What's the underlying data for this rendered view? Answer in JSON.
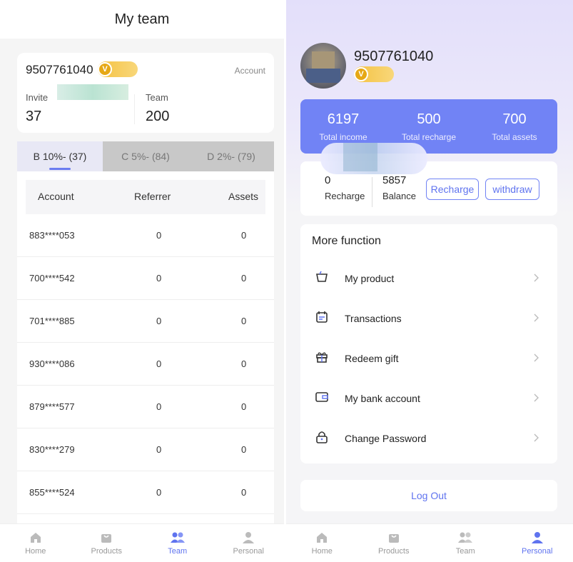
{
  "left": {
    "title": "My team",
    "phone": "9507761040",
    "badge_glyph": "V",
    "account_label": "Account",
    "invite_label": "Invite",
    "invite_value": "37",
    "team_label": "Team",
    "team_value": "200",
    "tabs": [
      {
        "label": "B 10%- (37)",
        "active": true
      },
      {
        "label": "C 5%- (84)",
        "active": false
      },
      {
        "label": "D 2%- (79)",
        "active": false
      }
    ],
    "table": {
      "headers": [
        "Account",
        "Referrer",
        "Assets"
      ],
      "rows": [
        [
          "883****053",
          "0",
          "0"
        ],
        [
          "700****542",
          "0",
          "0"
        ],
        [
          "701****885",
          "0",
          "0"
        ],
        [
          "930****086",
          "0",
          "0"
        ],
        [
          "879****577",
          "0",
          "0"
        ],
        [
          "830****279",
          "0",
          "0"
        ],
        [
          "855****524",
          "0",
          "0"
        ]
      ]
    },
    "tabbar": [
      {
        "label": "Home",
        "icon": "home-icon",
        "active": false
      },
      {
        "label": "Products",
        "icon": "bag-icon",
        "active": false
      },
      {
        "label": "Team",
        "icon": "team-icon",
        "active": true
      },
      {
        "label": "Personal",
        "icon": "person-icon",
        "active": false
      }
    ]
  },
  "right": {
    "phone": "9507761040",
    "badge_glyph": "V",
    "stats": [
      {
        "value": "6197",
        "label": "Total income"
      },
      {
        "value": "500",
        "label": "Total recharge"
      },
      {
        "value": "700",
        "label": "Total assets"
      }
    ],
    "recharge_value": "0",
    "recharge_label": "Recharge",
    "balance_value": "5857",
    "balance_label": "Balance",
    "recharge_button": "Recharge",
    "withdraw_button": "withdraw",
    "more_title": "More function",
    "menu": [
      {
        "label": "My product",
        "icon": "basket-icon"
      },
      {
        "label": "Transactions",
        "icon": "calendar-icon"
      },
      {
        "label": "Redeem gift",
        "icon": "gift-icon"
      },
      {
        "label": "My bank account",
        "icon": "wallet-icon"
      },
      {
        "label": "Change Password",
        "icon": "lock-icon"
      }
    ],
    "logout": "Log Out",
    "tabbar": [
      {
        "label": "Home",
        "icon": "home-icon",
        "active": false
      },
      {
        "label": "Products",
        "icon": "bag-icon",
        "active": false
      },
      {
        "label": "Team",
        "icon": "team-icon",
        "active": false
      },
      {
        "label": "Personal",
        "icon": "person-icon",
        "active": true
      }
    ]
  },
  "colors": {
    "accent": "#5f73ef",
    "stats_bg": "#7183f5",
    "badge": "#f5c242"
  }
}
